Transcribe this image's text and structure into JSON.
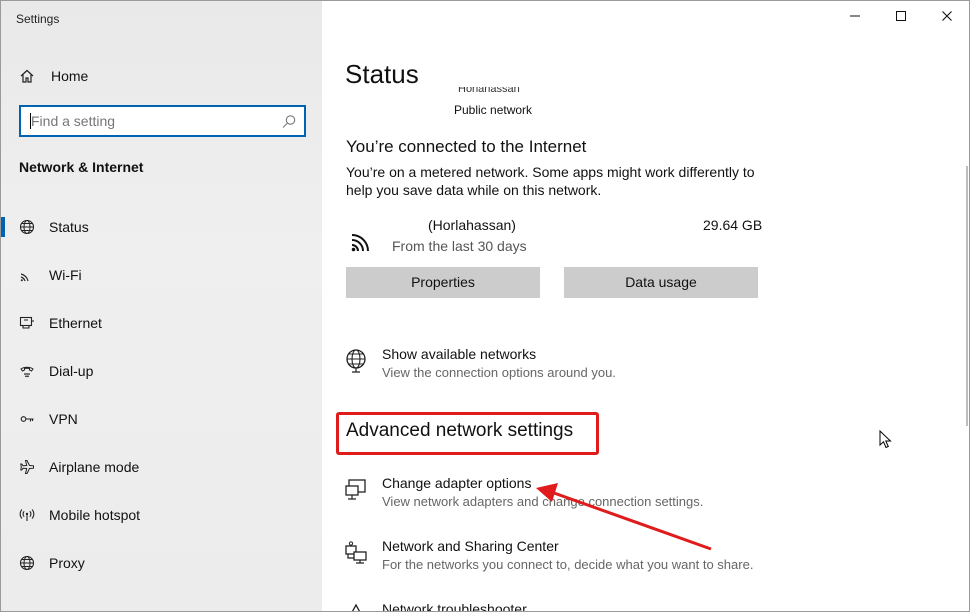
{
  "window": {
    "title": "Settings"
  },
  "titlebar": {
    "minimize_icon": "minimize-icon",
    "maximize_icon": "maximize-icon",
    "close_icon": "close-icon"
  },
  "sidebar": {
    "home_label": "Home",
    "search_placeholder": "Find a setting",
    "section_title": "Network & Internet",
    "items": [
      {
        "label": "Status",
        "icon": "globe-icon",
        "active": true
      },
      {
        "label": "Wi-Fi",
        "icon": "wifi-icon"
      },
      {
        "label": "Ethernet",
        "icon": "ethernet-icon"
      },
      {
        "label": "Dial-up",
        "icon": "dialup-icon"
      },
      {
        "label": "VPN",
        "icon": "vpn-icon"
      },
      {
        "label": "Airplane mode",
        "icon": "airplane-icon"
      },
      {
        "label": "Mobile hotspot",
        "icon": "hotspot-icon"
      },
      {
        "label": "Proxy",
        "icon": "globe-icon"
      }
    ]
  },
  "main": {
    "title": "Status",
    "clipped_network_name": "Horlahassan",
    "network_type": "Public network",
    "connected_heading": "You’re connected to the Internet",
    "connected_desc": "You’re on a metered network. Some apps might work differently to help you save data while on this network.",
    "network": {
      "name": "(Horlahassan)",
      "period": "From the last 30 days",
      "usage": "29.64 GB"
    },
    "buttons": {
      "properties": "Properties",
      "data_usage": "Data usage"
    },
    "show_networks": {
      "title": "Show available networks",
      "desc": "View the connection options around you."
    },
    "advanced_heading": "Advanced network settings",
    "options": [
      {
        "title": "Change adapter options",
        "desc": "View network adapters and change connection settings."
      },
      {
        "title": "Network and Sharing Center",
        "desc": "For the networks you connect to, decide what you want to share."
      },
      {
        "title": "Network troubleshooter",
        "desc": ""
      }
    ]
  },
  "colors": {
    "accent": "#0063b1",
    "annotation": "#e01b1b",
    "button_bg": "#cccccc"
  }
}
